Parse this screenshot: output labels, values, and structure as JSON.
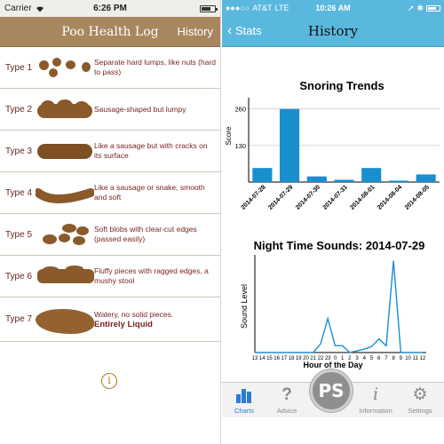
{
  "left": {
    "status": {
      "carrier": "Carrier",
      "time": "6:26 PM"
    },
    "navbar": {
      "title": "Poo Health Log",
      "history_label": "History"
    },
    "types": [
      {
        "label": "Type 1",
        "desc": "Separate hard lumps, like nuts (hard to pass)"
      },
      {
        "label": "Type 2",
        "desc": "Sausage-shaped but lumpy"
      },
      {
        "label": "Type 3",
        "desc": "Like a sausage but with cracks on its surface"
      },
      {
        "label": "Type 4",
        "desc": "Like a sausage or snake, smooth and soft"
      },
      {
        "label": "Type 5",
        "desc": "Soft blobs with clear-cut edges (passed easily)"
      },
      {
        "label": "Type 6",
        "desc": "Fluffy pieces with ragged edges, a mushy stool"
      },
      {
        "label": "Type 7",
        "desc": "Watery, no solid pieces.",
        "desc_bold": "Entirely Liquid"
      }
    ],
    "info_icon": "i"
  },
  "right": {
    "status": {
      "carrier": "AT&T",
      "network": "LTE",
      "time": "10:26 AM"
    },
    "navbar": {
      "back_label": "Stats",
      "title": "History"
    },
    "tabs": [
      {
        "label": "Charts",
        "icon": "bar-chart-icon"
      },
      {
        "label": "Advice",
        "icon": "question-icon"
      },
      {
        "label": "Information",
        "icon": "info-icon"
      },
      {
        "label": "Settings",
        "icon": "gear-icon"
      }
    ],
    "center_button_label": "PS"
  },
  "colors": {
    "accent_brown": "#a8875f",
    "accent_blue": "#5ab8de",
    "bar_blue": "#1a8fd0",
    "tab_active": "#2b7cd3"
  },
  "chart_data": [
    {
      "type": "bar",
      "title": "Snoring Trends",
      "ylabel": "Score",
      "xlabel": "",
      "categories": [
        "2014-07-28",
        "2014-07-29",
        "2014-07-30",
        "2014-07-31",
        "2014-08-01",
        "2014-08-04",
        "2014-08-05"
      ],
      "values": [
        50,
        260,
        20,
        8,
        50,
        5,
        27
      ],
      "yticks": [
        130,
        260
      ],
      "ylim": [
        0,
        300
      ],
      "grid": true
    },
    {
      "type": "line",
      "title": "Night Time Sounds: 2014-07-29",
      "ylabel": "Sound Level",
      "xlabel": "Hour of the Day",
      "categories": [
        "13",
        "14",
        "15",
        "16",
        "17",
        "18",
        "19",
        "20",
        "21",
        "22",
        "23",
        "0",
        "1",
        "2",
        "3",
        "4",
        "5",
        "6",
        "7",
        "8",
        "9",
        "10",
        "11",
        "12"
      ],
      "values": [
        0,
        0,
        0,
        0,
        0,
        0,
        0,
        0,
        0,
        10,
        40,
        8,
        8,
        0,
        2,
        4,
        7,
        16,
        8,
        108,
        0,
        0,
        0,
        0
      ],
      "ylim": [
        0,
        115
      ],
      "grid": false
    }
  ]
}
